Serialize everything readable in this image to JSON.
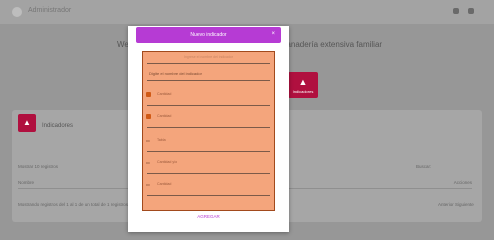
{
  "topbar": {
    "title": "Administrador"
  },
  "background": {
    "heading_left": "We",
    "heading_right": "panadería extensiva familiar",
    "tile": {
      "label": "Indicadores"
    },
    "card": {
      "title": "Indicadores",
      "show_label": "Mostrar 10 registros",
      "search_label": "Buscar:",
      "headers": [
        "Nombre",
        "Acciones"
      ],
      "row": "Mostrando registros del 1 al 1 de un total de 1 registros",
      "row_right": "Anterior  Siguiente"
    }
  },
  "modal": {
    "title": "Nuevo indicador",
    "close": "×",
    "hint": "Ingrese el nombre del indicador",
    "name_label": "Digite el nombre del indicador",
    "rows": [
      {
        "icon": "",
        "text": "Cantidad"
      },
      {
        "icon": "",
        "text": "Cantidad"
      },
      {
        "icon": "▭",
        "text": "Tabla"
      },
      {
        "icon": "▭",
        "text": "Cantidad  y/o"
      },
      {
        "icon": "▭",
        "text": "Cantidad"
      }
    ],
    "add_label": "AGREGAR"
  },
  "colors": {
    "accent": "#b63bd4",
    "brand": "#b0103f",
    "selection": "#f4a57c"
  }
}
